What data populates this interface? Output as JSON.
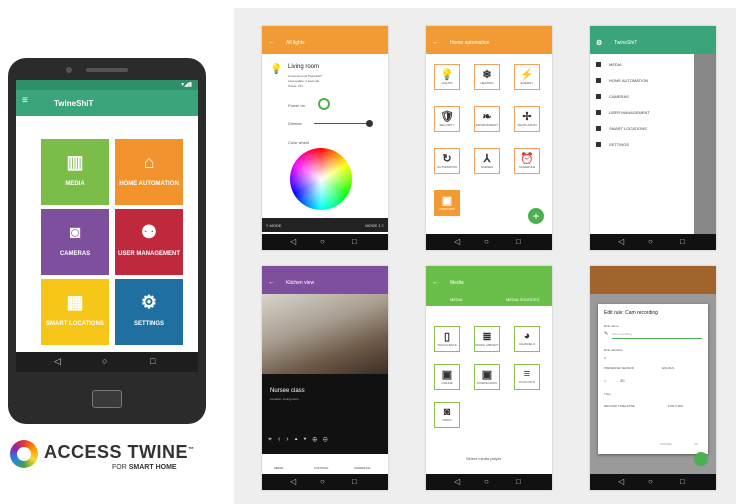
{
  "hero": {
    "app_title": "TwineShiT",
    "tiles": [
      {
        "label": "MEDIA",
        "icon": "film-icon",
        "color": "#7cbd4a"
      },
      {
        "label": "HOME AUTOMATION",
        "icon": "house-icon",
        "color": "#f2932d"
      },
      {
        "label": "CAMERAS",
        "icon": "camera-icon",
        "color": "#7d4f9c"
      },
      {
        "label": "USER MANAGEMENT",
        "icon": "users-icon",
        "color": "#c0283d"
      },
      {
        "label": "SMART LOCATIONS",
        "icon": "building-icon",
        "color": "#f5c518"
      },
      {
        "label": "SETTINGS",
        "icon": "gear-icon",
        "color": "#1f6fa0"
      }
    ]
  },
  "brand": {
    "name": "ACCESS TWINE",
    "tm": "™",
    "for": "FOR",
    "tagline": "SMART HOME"
  },
  "screens": {
    "lights": {
      "title": "All lights",
      "device": "Living room",
      "info": [
        "Connected via TwineShiT",
        "Last update: 2 seconds",
        "Power: ON"
      ],
      "power_label": "Power on",
      "dimmer_label": "Dimmer",
      "color_label": "Color wheel",
      "mode_left": "≡ MODE",
      "mode_right": "MODE 1 ≡",
      "color": "#f29a34"
    },
    "automation": {
      "title": "Home automation",
      "color": "#f29a34",
      "items": [
        {
          "label": "LIGHTS",
          "icon": "bulb-icon",
          "glyph": "💡"
        },
        {
          "label": "HEATING",
          "icon": "radiator-icon",
          "glyph": "❄"
        },
        {
          "label": "ENERGY",
          "icon": "plug-icon",
          "glyph": "⚡"
        },
        {
          "label": "SECURITY",
          "icon": "shield-icon",
          "glyph": "🛡"
        },
        {
          "label": "ENVIRONMENT",
          "icon": "leaf-icon",
          "glyph": "❧"
        },
        {
          "label": "VENTILATION",
          "icon": "fan-icon",
          "glyph": "✢"
        },
        {
          "label": "AUTOMATION",
          "icon": "refresh-icon",
          "glyph": "↻"
        },
        {
          "label": "SCENES",
          "icon": "network-icon",
          "glyph": "⅄"
        },
        {
          "label": "SCHEDULE",
          "icon": "alarm-icon",
          "glyph": "⏰"
        },
        {
          "label": "WINDOWS",
          "icon": "window-icon",
          "glyph": "▣"
        }
      ]
    },
    "drawer": {
      "title": "TwineShiT",
      "color": "#3aa57a",
      "items": [
        "MEDIA",
        "HOME AUTOMATION",
        "CAMERAS",
        "USER MANAGEMENT",
        "SMART LOCATIONS",
        "SETTINGS"
      ]
    },
    "camera": {
      "title": "Kitchen view",
      "color": "#7d4f9c",
      "room": "Nursee class",
      "sub": "Location: Living room",
      "tabs": [
        "MEDIA",
        "CONTROL",
        "SCHEDULE"
      ]
    },
    "media": {
      "title": "Media",
      "color": "#6abf4b",
      "tabs": [
        "MEDIA",
        "MEDIA SOURCES"
      ],
      "items": [
        "TOUCH BACK",
        "MUSIC LIBRARY",
        "CHANNELS",
        "ONLINE",
        "DOWNLOADS",
        "PLAYLISTS",
        "VIDEO"
      ],
      "footer": "Select media player"
    },
    "dialog": {
      "title": "Edit rule: Cam recording",
      "color": "#e08a2f",
      "rule_name_label": "Rule name",
      "rule_name_value": "Cam recording",
      "rule_def_label": "Rule definition",
      "if": "If",
      "field1": "PRESENCE SENSOR",
      "field2": "EQUALS",
      "eq": "=",
      "num": "30",
      "then": "Then",
      "then_field": "RECORD TIMELAPSE",
      "then_field2": "FOR 5 MIN",
      "cancel": "CANCEL",
      "ok": "OK"
    }
  }
}
